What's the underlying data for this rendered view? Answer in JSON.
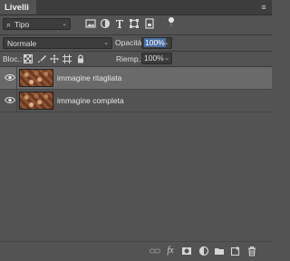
{
  "panel": {
    "tab_title": "Livelli",
    "menu_icon": "panel-menu-icon"
  },
  "filter": {
    "kind_label": "Tipo",
    "icons": [
      "image-layer-filter-icon",
      "adjustment-layer-filter-icon",
      "type-layer-filter-icon",
      "shape-layer-filter-icon",
      "smart-object-filter-icon",
      "filter-toggle-icon"
    ]
  },
  "blend": {
    "mode": "Normale",
    "opacity_label": "Opacità:",
    "opacity_value": "100%",
    "lock_label": "Bloc.:",
    "fill_label": "Riemp.:",
    "fill_value": "100%"
  },
  "layers": [
    {
      "name": "immagine ritagliata",
      "visible": true,
      "selected": true
    },
    {
      "name": "immagine completa",
      "visible": true,
      "selected": false
    }
  ],
  "footer": {
    "icons": [
      "link-layers-icon",
      "fx-icon",
      "mask-icon",
      "adjustment-icon",
      "group-folder-icon",
      "new-layer-icon",
      "trash-icon"
    ],
    "fx_label": "fx"
  },
  "colors": {
    "panel_bg": "#535353",
    "selected_row": "#6a6a6a",
    "highlight": "#4a6fa5"
  }
}
